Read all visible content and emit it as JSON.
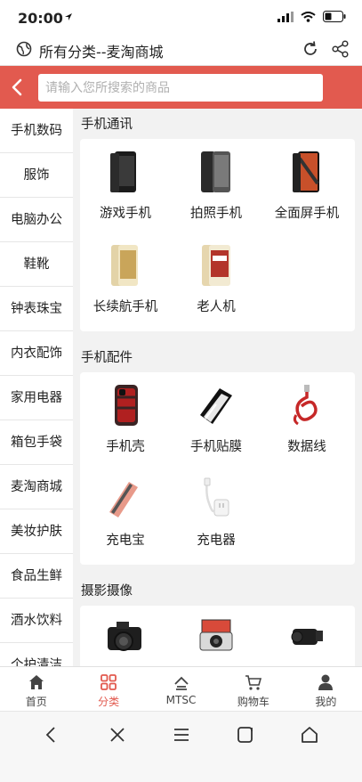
{
  "status": {
    "time": "20:00"
  },
  "browser": {
    "title": "所有分类--麦淘商城"
  },
  "search": {
    "placeholder": "请输入您所搜索的商品"
  },
  "sidebar": {
    "items": [
      {
        "label": "手机数码"
      },
      {
        "label": "服饰"
      },
      {
        "label": "电脑办公"
      },
      {
        "label": "鞋靴"
      },
      {
        "label": "钟表珠宝"
      },
      {
        "label": "内衣配饰"
      },
      {
        "label": "家用电器"
      },
      {
        "label": "箱包手袋"
      },
      {
        "label": "麦淘商城"
      },
      {
        "label": "美妆护肤"
      },
      {
        "label": "食品生鲜"
      },
      {
        "label": "酒水饮料"
      },
      {
        "label": "个护清洁"
      }
    ]
  },
  "sections": [
    {
      "title": "手机通讯",
      "items": [
        {
          "label": "游戏手机",
          "icon": "black-phone-icon"
        },
        {
          "label": "拍照手机",
          "icon": "camera-phone-icon"
        },
        {
          "label": "全面屏手机",
          "icon": "fullscreen-phone-icon"
        },
        {
          "label": "长续航手机",
          "icon": "gold-phone-icon"
        },
        {
          "label": "老人机",
          "icon": "senior-phone-icon"
        }
      ]
    },
    {
      "title": "手机配件",
      "items": [
        {
          "label": "手机壳",
          "icon": "phone-case-icon"
        },
        {
          "label": "手机贴膜",
          "icon": "screen-film-icon"
        },
        {
          "label": "数据线",
          "icon": "cable-icon"
        },
        {
          "label": "充电宝",
          "icon": "power-bank-icon"
        },
        {
          "label": "充电器",
          "icon": "charger-icon"
        }
      ]
    },
    {
      "title": "摄影摄像",
      "items": [
        {
          "label": "",
          "icon": "dslr-camera-icon"
        },
        {
          "label": "",
          "icon": "instant-camera-icon"
        },
        {
          "label": "",
          "icon": "camcorder-icon"
        }
      ]
    }
  ],
  "tabs": [
    {
      "label": "首页",
      "icon": "home-icon"
    },
    {
      "label": "分类",
      "icon": "category-icon",
      "active": true
    },
    {
      "label": "MTSC",
      "icon": "mtsc-icon"
    },
    {
      "label": "购物车",
      "icon": "cart-icon"
    },
    {
      "label": "我的",
      "icon": "user-icon"
    }
  ],
  "colors": {
    "accent": "#e25a4f",
    "text": "#222222",
    "background": "#f2f2f2"
  }
}
